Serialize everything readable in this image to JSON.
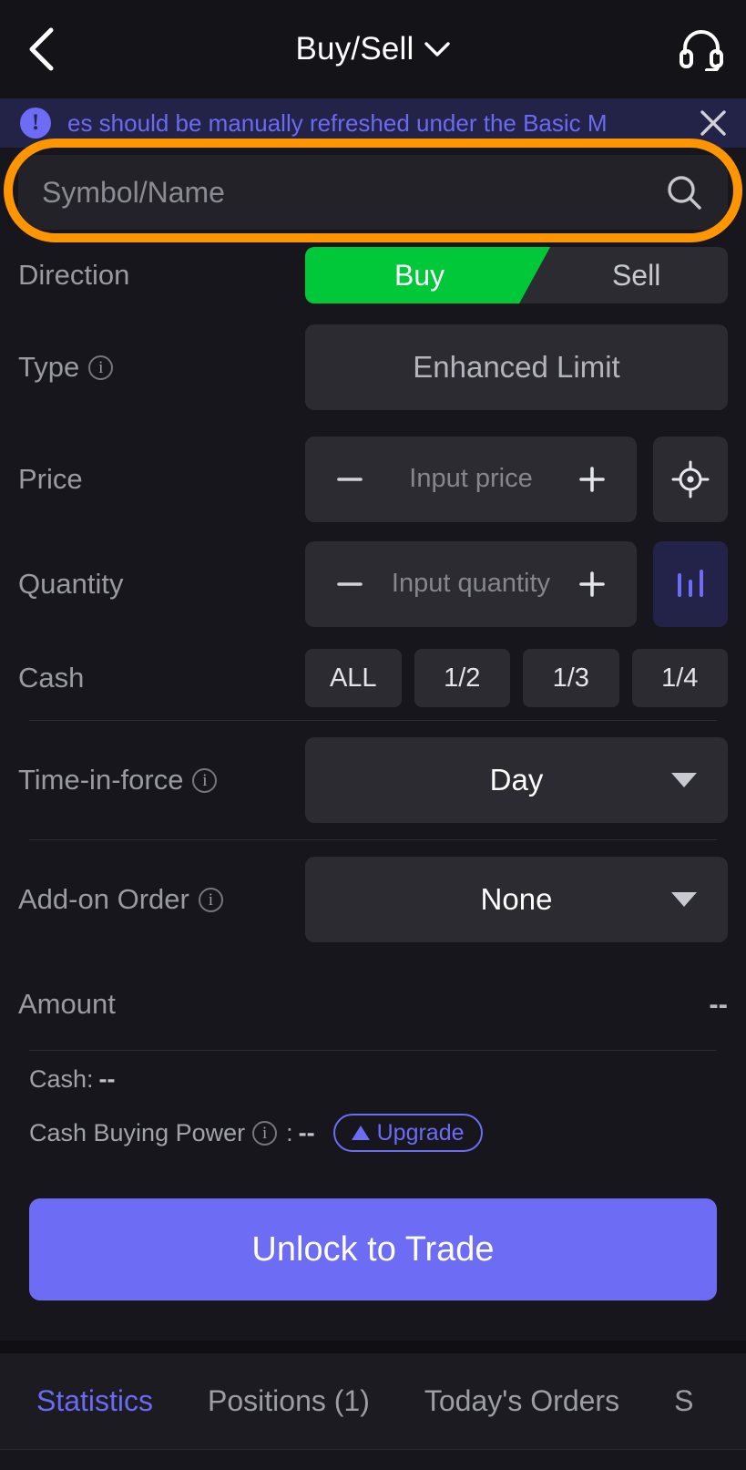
{
  "header": {
    "title": "Buy/Sell",
    "back_icon": "chevron-left-icon",
    "dropdown_icon": "chevron-down-icon",
    "support_icon": "headset-icon"
  },
  "banner": {
    "icon": "exclamation-circle-icon",
    "text": "es should be manually refreshed under the Basic M",
    "close_icon": "close-icon",
    "bg_color": "#232348",
    "text_color": "#6a6af2"
  },
  "search": {
    "placeholder": "Symbol/Name",
    "value": "",
    "icon": "search-icon",
    "highlight_color": "#ff9500"
  },
  "form": {
    "direction": {
      "label": "Direction",
      "buy_label": "Buy",
      "sell_label": "Sell",
      "selected": "Buy",
      "buy_color": "#00c838"
    },
    "type": {
      "label": "Type",
      "info_icon": "info-icon",
      "value": "Enhanced Limit"
    },
    "price": {
      "label": "Price",
      "placeholder": "Input price",
      "value": "",
      "minus_icon": "minus-icon",
      "plus_icon": "plus-icon",
      "side_icon": "target-crosshair-icon"
    },
    "quantity": {
      "label": "Quantity",
      "placeholder": "Input quantity",
      "value": "",
      "minus_icon": "minus-icon",
      "plus_icon": "plus-icon",
      "side_icon": "bar-chart-icon"
    },
    "cash": {
      "label": "Cash",
      "buttons": [
        "ALL",
        "1/2",
        "1/3",
        "1/4"
      ]
    },
    "time_in_force": {
      "label": "Time-in-force",
      "info_icon": "info-icon",
      "value": "Day",
      "caret_icon": "caret-down-icon"
    },
    "add_on_order": {
      "label": "Add-on Order",
      "info_icon": "info-icon",
      "value": "None",
      "caret_icon": "caret-down-icon"
    },
    "amount": {
      "label": "Amount",
      "value": "--"
    }
  },
  "account": {
    "cash_label": "Cash:",
    "cash_value": "--",
    "buying_power_label": "Cash Buying Power",
    "buying_power_info_icon": "info-icon",
    "buying_power_separator": ":",
    "buying_power_value": "--",
    "upgrade_label": "Upgrade",
    "upgrade_icon": "arrow-up-icon"
  },
  "cta": {
    "label": "Unlock to Trade",
    "color": "#6c6cf5"
  },
  "bottom_tabs": {
    "active": "Statistics",
    "items": [
      {
        "label": "Statistics"
      },
      {
        "label": "Positions (1)"
      },
      {
        "label": "Today's Orders"
      },
      {
        "label": "S"
      }
    ]
  }
}
